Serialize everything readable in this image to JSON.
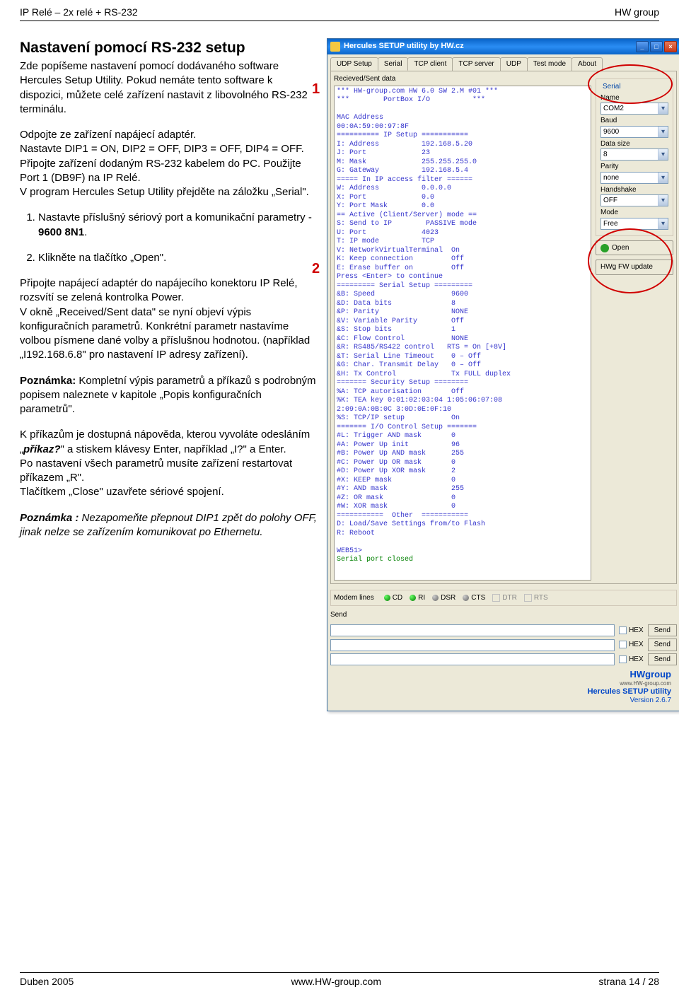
{
  "header": {
    "left": "IP Relé – 2x relé + RS-232",
    "right": "HW group"
  },
  "footer": {
    "left": "Duben 2005",
    "center": "www.HW-group.com",
    "right": "strana 14 / 28"
  },
  "section_title": "Nastavení pomocí RS-232 setup",
  "p1": "Zde popíšeme nastavení pomocí dodávaného software Hercules Setup Utility. Pokud nemáte tento software k dispozici, můžete celé zařízení nastavit z libovolného RS-232 terminálu.",
  "p2a": "Odpojte ze zařízení napájecí adaptér.",
  "p2b": "Nastavte DIP1 = ON,  DIP2 = OFF,  DIP3 = OFF,  DIP4 = OFF.",
  "p2c": "Připojte zařízení dodaným RS-232 kabelem do PC. Použijte Port 1 (DB9F) na IP Relé.",
  "p2d": "V program Hercules Setup Utility přejděte na záložku „Serial\".",
  "step1_a": "Nastavte příslušný sériový port a komunikační parametry - ",
  "step1_b": "9600 8N1",
  "step1_c": ".",
  "step2": "Klikněte na tlačítko „Open\".",
  "p3": "Připojte napájecí adaptér do napájecího konektoru IP Relé, rozsvítí se zelená kontrolka Power.",
  "p4": "V okně „Received/Sent data\" se nyní objeví výpis konfiguračních parametrů. Konkrétní parametr nastavíme volbou písmene dané volby a příslušnou hodnotou. (například „I192.168.6.8\" pro nastavení IP adresy zařízení).",
  "p5a": "Poznámka:",
  "p5b": " Kompletní výpis parametrů a příkazů s podrobným popisem naleznete v kapitole „Popis konfiguračních parametrů\".",
  "p6a": "K příkazům je dostupná nápověda, kterou vyvoláte odesláním „",
  "p6b": "příkaz?",
  "p6c": "\" a stiskem klávesy Enter, například „I?\" a Enter.",
  "p7": "Po nastavení všech parametrů musíte zařízení restartovat příkazem „R\".",
  "p8": "Tlačítkem „Close\" uzavřete sériové spojení.",
  "p9a": "Poznámka :",
  "p9b": " Nezapomeňte přepnout DIP1 zpět do polohy OFF, jinak nelze se zařízením komunikovat po Ethernetu.",
  "hercules": {
    "title": "Hercules SETUP utility by HW.cz",
    "tabs": [
      "UDP Setup",
      "Serial",
      "TCP client",
      "TCP server",
      "UDP",
      "Test mode",
      "About"
    ],
    "active_tab": "Serial",
    "received_label": "Recieved/Sent data",
    "terminal_lines": "*** HW-group.com HW 6.0 SW 2.M #01 ***\n***        PortBox I/O          ***\n\nMAC Address              \n00:0A:59:00:97:8F\n========== IP Setup ===========\nI: Address          192.168.5.20\nJ: Port             23\nM: Mask             255.255.255.0\nG: Gateway          192.168.5.4\n===== In IP access filter ======\nW: Address          0.0.0.0\nX: Port             0.0\nY: Port Mask        0.0\n== Active (Client/Server) mode ==\nS: Send to IP        PASSIVE mode\nU: Port             4023\nT: IP mode          TCP\nV: NetworkVirtualTerminal  On\nK: Keep connection         Off\nE: Erase buffer on         Off\nPress <Enter> to continue\n========= Serial Setup =========\n&B: Speed                  9600\n&D: Data bits              8\n&P: Parity                 NONE\n&V: Variable Parity        Off\n&S: Stop bits              1\n&C: Flow Control           NONE\n&R: RS485/RS422 control   RTS = On [+8V]\n&T: Serial Line Timeout    0 – Off\n&G: Char. Transmit Delay   0 – Off\n&H: Tx Control             Tx FULL duplex\n======= Security Setup ========\n%A: TCP autorisation       Off\n%K: TEA key 0:01:02:03:04 1:05:06:07:08\n2:09:0A:0B:0C 3:0D:0E:0F:10\n%S: TCP/IP setup           On\n======= I/O Control Setup =======\n#L: Trigger AND mask       0\n#A: Power Up init          96\n#B: Power Up AND mask      255\n#C: Power Up OR mask       0\n#D: Power Up XOR mask      2\n#X: KEEP mask              0\n#Y: AND mask               255\n#Z: OR mask                0\n#W: XOR mask               0\n===========  Other  ===========\nD: Load/Save Settings from/to Flash\nR: Reboot\n\nWEB51>",
    "closed_line": "Serial port closed",
    "serial_group": "Serial",
    "labels": {
      "name": "Name",
      "baud": "Baud",
      "data": "Data size",
      "parity": "Parity",
      "handshake": "Handshake",
      "mode": "Mode"
    },
    "values": {
      "name": "COM2",
      "baud": "9600",
      "data": "8",
      "parity": "none",
      "handshake": "OFF",
      "mode": "Free"
    },
    "open_btn": "Open",
    "update_btn": "HWg FW update",
    "callout1": "1",
    "callout2": "2",
    "modem_label": "Modem lines",
    "leds": [
      "CD",
      "RI",
      "DSR",
      "CTS"
    ],
    "chks": [
      "DTR",
      "RTS"
    ],
    "send_label": "Send",
    "hex_label": "HEX",
    "send_btn": "Send",
    "brand": {
      "hwg1": "HW",
      "hwg2": "group",
      "url": "www.HW-group.com",
      "title": "Hercules SETUP utility",
      "ver": "Version 2.6.7"
    }
  }
}
